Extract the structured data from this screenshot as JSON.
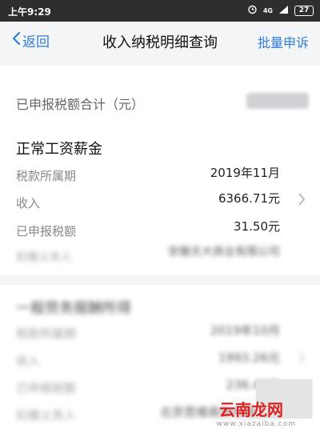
{
  "status_bar": {
    "time": "上午9:29",
    "network": "4G",
    "battery": "27"
  },
  "nav": {
    "back_label": "返回",
    "title": "收入纳税明细查询",
    "action_label": "批量申诉"
  },
  "summary": {
    "total_label": "已申报税额合计（元）"
  },
  "record1": {
    "title": "正常工资薪金",
    "period_label": "税款所属期",
    "period_value": "2019年11月",
    "income_label": "收入",
    "income_value": "6366.71元",
    "tax_label": "已申报税额",
    "tax_value": "31.50元",
    "payer_label": "扣缴义务人",
    "payer_value": "安徽天大商业有限公司"
  },
  "record2": {
    "title": "一般劳务报酬所得",
    "period_label": "税款所属期",
    "period_value": "2019年10月",
    "income_label": "收入",
    "income_value": "1993.26元",
    "tax_label": "已申报税额",
    "tax_value": "236.43元",
    "payer_label": "扣缴义务人",
    "payer_value": "北京思维商务有限公司"
  },
  "watermark": {
    "main_a": "云南",
    "main_b": "龙网",
    "sub": "www.xiazaiba.com"
  },
  "colors": {
    "accent": "#2f7dd6",
    "status_bar": "#2e2e2e",
    "page_bg": "#f4f5f7"
  }
}
